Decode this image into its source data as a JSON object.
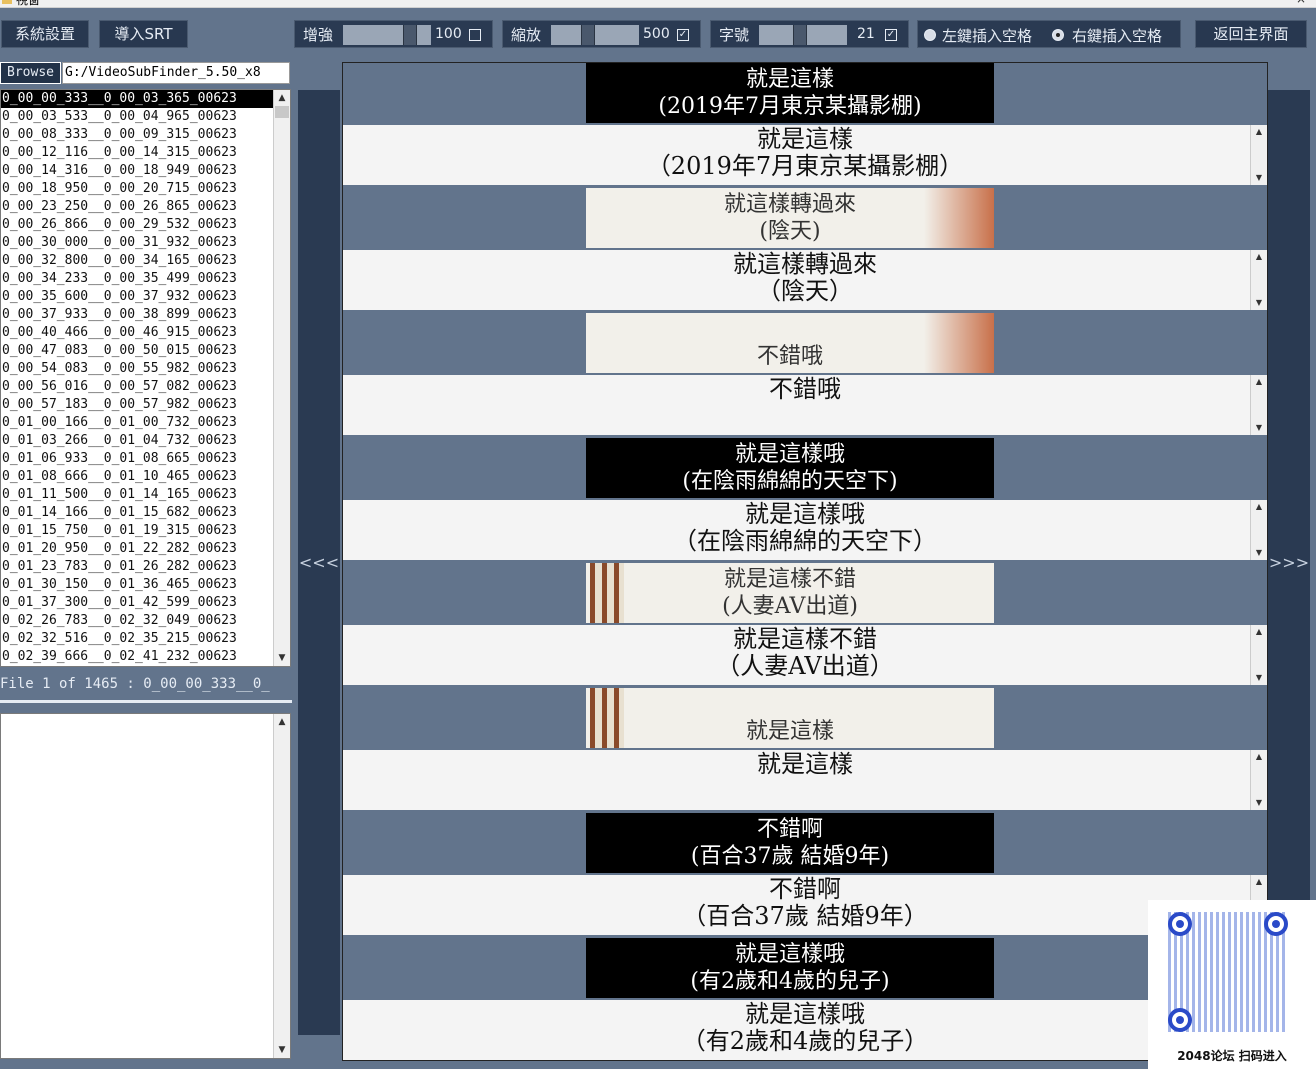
{
  "window": {
    "title": "視窗"
  },
  "toolbar": {
    "settings": "系統設置",
    "import_srt": "導入SRT",
    "enhance": {
      "label": "增強",
      "value": "100",
      "checked": false
    },
    "zoom": {
      "label": "縮放",
      "value": "500",
      "checked": true
    },
    "font_size": {
      "label": "字號",
      "value": "21",
      "checked": true
    },
    "left_insert": {
      "label": "左鍵插入空格",
      "selected": false
    },
    "right_insert": {
      "label": "右鍵插入空格",
      "selected": true
    },
    "back": "返回主界面"
  },
  "browser": {
    "button": "Browse",
    "path": "G:/VideoSubFinder_5.50_x8"
  },
  "files": [
    "0_00_00_333__0_00_03_365_00623",
    "0_00_03_533__0_00_04_965_00623",
    "0_00_08_333__0_00_09_315_00623",
    "0_00_12_116__0_00_14_315_00623",
    "0_00_14_316__0_00_18_949_00623",
    "0_00_18_950__0_00_20_715_00623",
    "0_00_23_250__0_00_26_865_00623",
    "0_00_26_866__0_00_29_532_00623",
    "0_00_30_000__0_00_31_932_00623",
    "0_00_32_800__0_00_34_165_00623",
    "0_00_34_233__0_00_35_499_00623",
    "0_00_35_600__0_00_37_932_00623",
    "0_00_37_933__0_00_38_899_00623",
    "0_00_40_466__0_00_46_915_00623",
    "0_00_47_083__0_00_50_015_00623",
    "0_00_54_083__0_00_55_982_00623",
    "0_00_56_016__0_00_57_082_00623",
    "0_00_57_183__0_00_57_982_00623",
    "0_01_00_166__0_01_00_732_00623",
    "0_01_03_266__0_01_04_732_00623",
    "0_01_06_933__0_01_08_665_00623",
    "0_01_08_666__0_01_10_465_00623",
    "0_01_11_500__0_01_14_165_00623",
    "0_01_14_166__0_01_15_682_00623",
    "0_01_15_750__0_01_19_315_00623",
    "0_01_20_950__0_01_22_282_00623",
    "0_01_23_783__0_01_26_282_00623",
    "0_01_30_150__0_01_36_465_00623",
    "0_01_37_300__0_01_42_599_00623",
    "0_02_26_783__0_02_32_049_00623",
    "0_02_32_516__0_02_35_215_00623",
    "0_02_39_666__0_02_41_232_00623"
  ],
  "status": "File 1 of 1465 :  0_00_00_333__0_",
  "nav": {
    "prev": "<<<",
    "next": ">>>"
  },
  "subtitles": [
    {
      "caption": [
        "就是這樣",
        "(2019年7月東京某攝影棚)"
      ],
      "style": "dark",
      "text": [
        "就是這樣",
        "（2019年7月東京某攝影棚）"
      ]
    },
    {
      "caption": [
        "就這樣轉過來",
        "(陰天)"
      ],
      "style": "light-right",
      "text": [
        "就這樣轉過來",
        "（陰天）"
      ]
    },
    {
      "caption": [
        "",
        "不錯哦"
      ],
      "style": "light-right",
      "text": [
        "不錯哦",
        ""
      ]
    },
    {
      "caption": [
        "就是這樣哦",
        "(在陰雨綿綿的天空下)"
      ],
      "style": "dark",
      "text": [
        "就是這樣哦",
        "（在陰雨綿綿的天空下）"
      ]
    },
    {
      "caption": [
        "就是這樣不錯",
        "(人妻AV出道)"
      ],
      "style": "light-left",
      "text": [
        "就是這樣不錯",
        "（人妻AV出道）"
      ]
    },
    {
      "caption": [
        "",
        "就是這樣"
      ],
      "style": "light-left",
      "text": [
        "就是這樣",
        ""
      ]
    },
    {
      "caption": [
        "不錯啊",
        "(百合37歲 結婚9年)"
      ],
      "style": "dark",
      "text": [
        "不錯啊",
        "（百合37歲 結婚9年）"
      ]
    },
    {
      "caption": [
        "就是這樣哦",
        "(有2歲和4歲的兒子)"
      ],
      "style": "dark",
      "text": [
        "就是這樣哦",
        "（有2歲和4歲的兒子）"
      ]
    }
  ],
  "qr": {
    "label": "2048论坛 扫码进入"
  }
}
